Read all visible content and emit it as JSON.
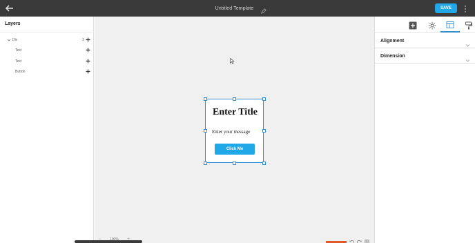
{
  "topbar": {
    "title": "Untitled Template",
    "save_label": "SAVE"
  },
  "layers_panel": {
    "title": "Layers",
    "items": [
      {
        "label": "Div",
        "count": "3",
        "expanded": true
      },
      {
        "label": "Text"
      },
      {
        "label": "Text"
      },
      {
        "label": "Button"
      }
    ]
  },
  "canvas": {
    "card": {
      "title": "Enter Title",
      "message": "Enter your message",
      "button_label": "Click Me"
    },
    "zoom_level": "100%"
  },
  "right_panel": {
    "tabs": [
      {
        "icon": "add-square-icon",
        "active": false
      },
      {
        "icon": "gear-icon",
        "active": false
      },
      {
        "icon": "layout-icon",
        "active": true
      },
      {
        "icon": "paint-roller-icon",
        "active": false
      }
    ],
    "sections": [
      {
        "label": "Alignment"
      },
      {
        "label": "Dimension"
      }
    ]
  },
  "colors": {
    "topbar_bg": "#3a3a3a",
    "accent": "#20a8e8",
    "selection": "#2f8fd6",
    "canvas_bg": "#f0f0f0"
  }
}
